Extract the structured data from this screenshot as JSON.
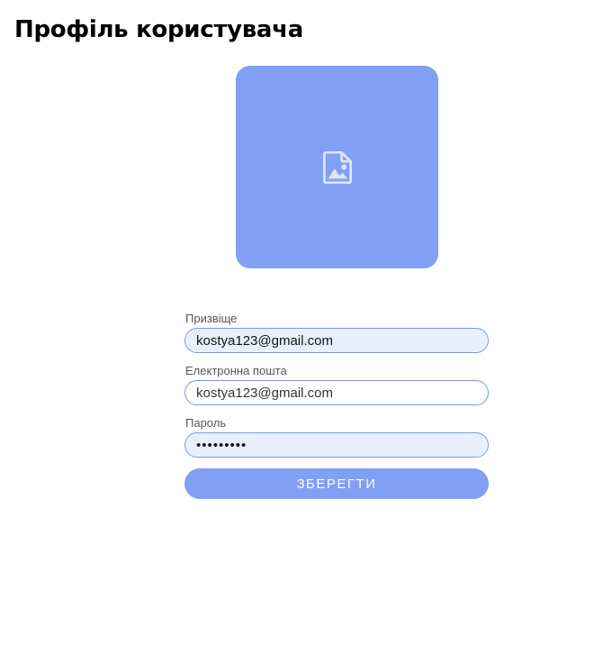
{
  "page": {
    "title": "Профіль користувача"
  },
  "avatar": {
    "icon": "image-placeholder-icon",
    "background_color": "#819ff5"
  },
  "form": {
    "fields": [
      {
        "label": "Призвіще",
        "value": "kostya123@gmail.com"
      },
      {
        "label": "Електронна пошта",
        "value": "kostya123@gmail.com"
      },
      {
        "label": "Пароль",
        "value": "•••••••••"
      }
    ],
    "submit_label": "ЗБЕРЕГТИ"
  },
  "colors": {
    "accent": "#819ff5",
    "input_border": "#7d97e8",
    "autofill_background": "#e8f0fe"
  }
}
